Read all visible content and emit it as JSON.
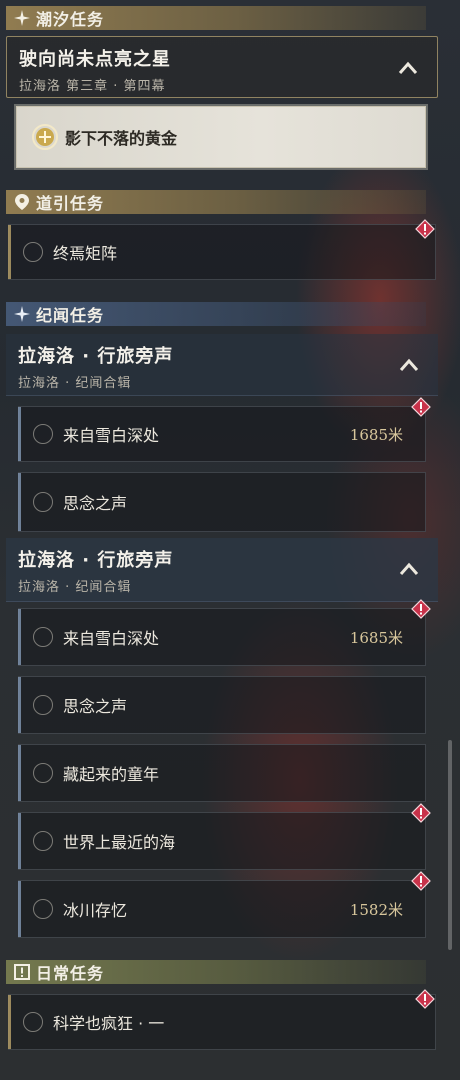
{
  "sections": {
    "tide": {
      "label": "潮汐任务",
      "group_title": "驶向尚未点亮之星",
      "group_sub": "拉海洛 第三章 · 第四幕",
      "active_item": "影下不落的黄金"
    },
    "guide": {
      "label": "道引任务",
      "item": "终焉矩阵"
    },
    "chronicle": {
      "label": "纪闻任务",
      "group_title": "拉海洛 · 行旅旁声",
      "group_sub": "拉海洛 · 纪闻合辑",
      "items": [
        {
          "label": "来自雪白深处",
          "distance": "1685米"
        },
        {
          "label": "思念之声"
        }
      ]
    },
    "chronicle2": {
      "group_title": "拉海洛 · 行旅旁声",
      "group_sub": "拉海洛 · 纪闻合辑",
      "items": [
        {
          "label": "来自雪白深处",
          "distance": "1685米"
        },
        {
          "label": "思念之声"
        },
        {
          "label": "藏起来的童年"
        },
        {
          "label": "世界上最近的海"
        },
        {
          "label": "冰川存忆",
          "distance": "1582米"
        }
      ]
    },
    "daily": {
      "label": "日常任务",
      "item": "科学也疯狂 · 一"
    }
  },
  "colors": {
    "gold_accent": "#b49a5e",
    "blue_accent": "#4a5e7c",
    "alert_red": "#c8324a",
    "distance_text": "#d8c79c"
  }
}
